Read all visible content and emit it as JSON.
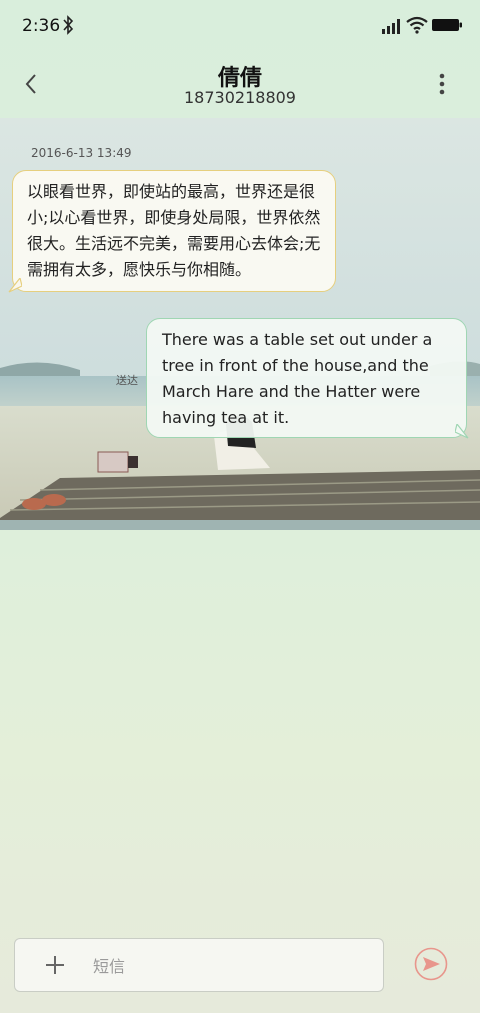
{
  "status_bar": {
    "time": "2:36"
  },
  "header": {
    "contact_name": "倩倩",
    "contact_number": "18730218809"
  },
  "conversation": {
    "timestamp": "2016-6-13 13:49",
    "messages": [
      {
        "direction": "incoming",
        "text": "以眼看世界，即使站的最高，世界还是很小;以心看世界，即使身处局限，世界依然很大。生活远不完美，需要用心去体会;无需拥有太多，愿快乐与你相随。"
      },
      {
        "direction": "outgoing",
        "text": "There was a table set out under a tree in front of the house,and the March Hare and the Hatter were having tea at it.",
        "status": "送达"
      }
    ]
  },
  "composer": {
    "placeholder": "短信",
    "value": ""
  },
  "icons": {
    "back": "chevron-left-icon",
    "more": "more-vert-icon",
    "add": "plus-icon",
    "send": "send-icon"
  },
  "colors": {
    "incoming_border": "#e6cf7e",
    "outgoing_border": "#9fd6b3",
    "send_accent": "#e8968c"
  }
}
